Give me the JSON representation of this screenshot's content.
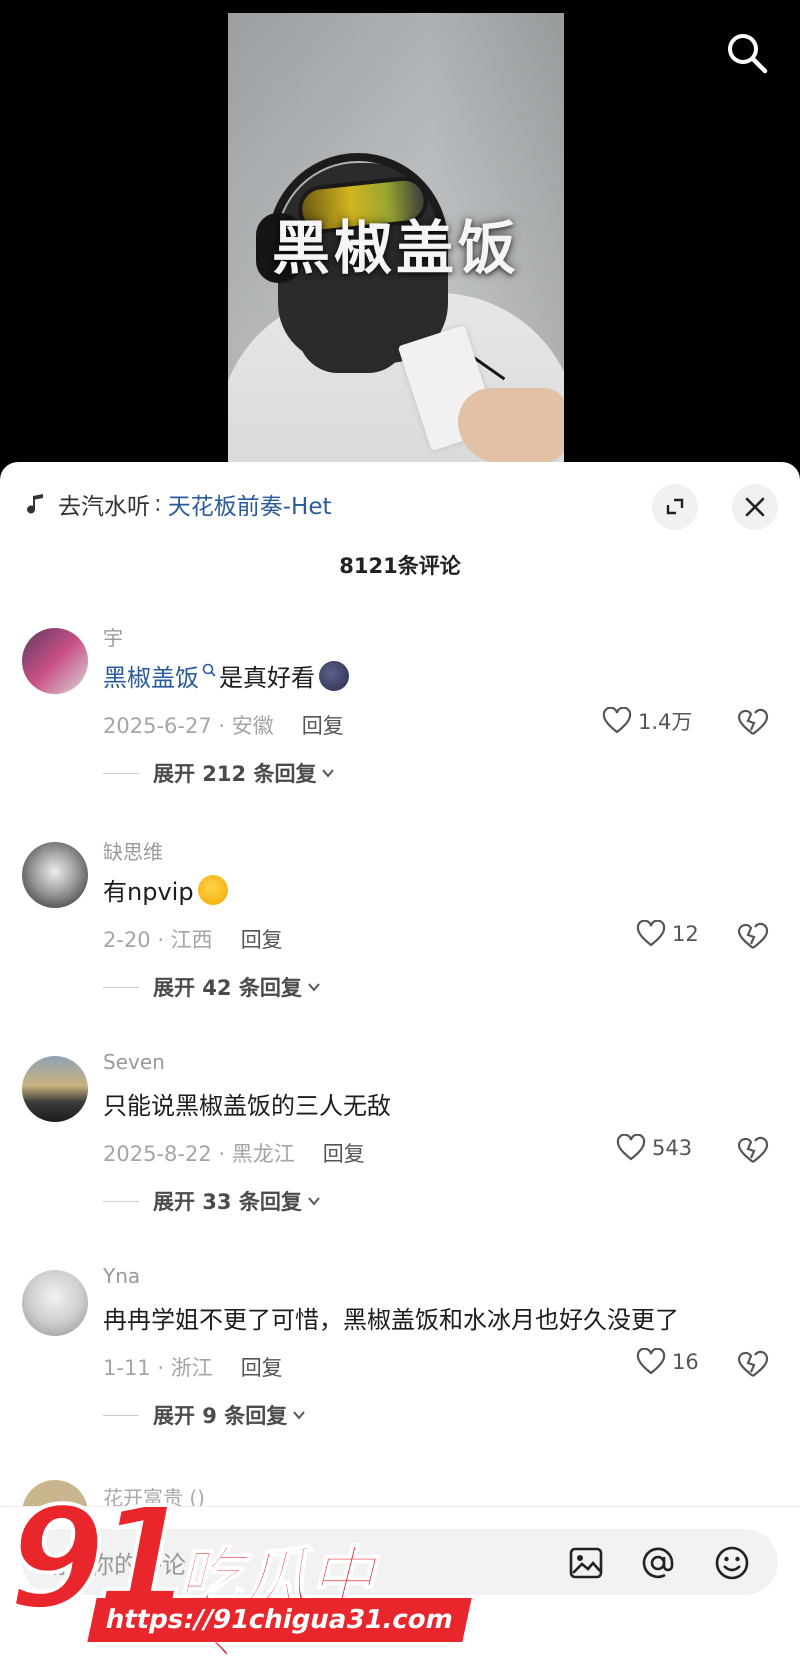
{
  "video": {
    "overlay_title": "黑椒盖饭"
  },
  "sheet": {
    "music_label": "去汽水听",
    "music_sep": ":",
    "music_song": "天花板前奏-Het",
    "comment_count": "8121条评论"
  },
  "comments": [
    {
      "user": "宇",
      "tag": "黑椒盖饭",
      "text": "是真好看",
      "date_location": "2025-6-27 · 安徽",
      "reply_label": "回复",
      "likes": "1.4万",
      "expand_label": "展开 212 条回复"
    },
    {
      "user": "缺思维",
      "tag": "",
      "text": "有npvip",
      "date_location": "2-20 · 江西",
      "reply_label": "回复",
      "likes": "12",
      "expand_label": "展开 42 条回复"
    },
    {
      "user": "Seven",
      "tag": "",
      "text": "只能说黑椒盖饭的三人无敌",
      "date_location": "2025-8-22 · 黑龙江",
      "reply_label": "回复",
      "likes": "543",
      "expand_label": "展开 33 条回复"
    },
    {
      "user": "Yna",
      "tag": "",
      "text": "冉冉学姐不更了可惜，黑椒盖饭和水冰月也好久没更了",
      "date_location": "1-11 · 浙江",
      "reply_label": "回复",
      "likes": "16",
      "expand_label": "展开 9 条回复"
    }
  ],
  "partial_comment_user": "花开富贵 ()",
  "input": {
    "placeholder": "期待你的评论"
  },
  "watermark": {
    "number": "91",
    "name": "吃瓜中心",
    "url": "https://91chigua31.com"
  },
  "colors": {
    "link_blue": "#2a5b9c",
    "watermark_red": "#e8262b"
  }
}
